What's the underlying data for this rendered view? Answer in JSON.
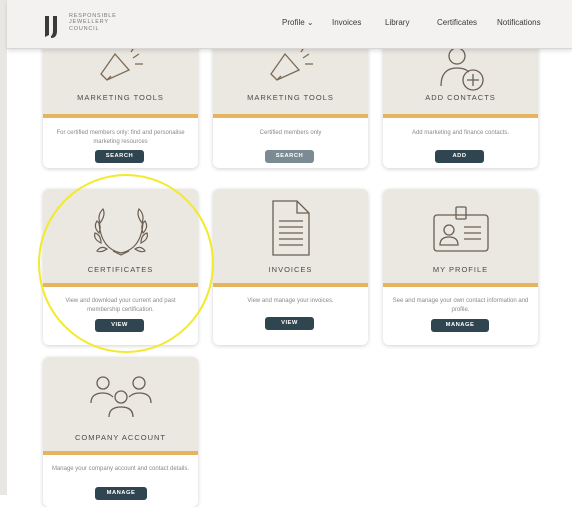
{
  "header": {
    "brand_lines": [
      "RESPONSIBLE",
      "JEWELLERY",
      "COUNCIL"
    ],
    "nav": [
      {
        "label": "Profile ⌄"
      },
      {
        "label": "Invoices"
      },
      {
        "label": "Library"
      },
      {
        "label": "Certificates"
      },
      {
        "label": "Notifications"
      }
    ]
  },
  "cards": [
    {
      "title": "MARKETING TOOLS",
      "desc": "For certified members only: find and personalise marketing resources",
      "button": "SEARCH",
      "icon": "megaphone-icon"
    },
    {
      "title": "MARKETING TOOLS",
      "desc": "Certified members only",
      "button": "SEARCH",
      "icon": "megaphone-icon",
      "disabled": true
    },
    {
      "title": "ADD CONTACTS",
      "desc": "Add marketing and finance contacts.",
      "button": "ADD",
      "icon": "add-contact-icon"
    },
    {
      "title": "CERTIFICATES",
      "desc": "View and download your current and past membership certification.",
      "button": "VIEW",
      "icon": "laurel-wreath-icon"
    },
    {
      "title": "INVOICES",
      "desc": "View and manage your invoices.",
      "button": "VIEW",
      "icon": "document-icon"
    },
    {
      "title": "MY PROFILE",
      "desc": "See and manage your own contact information and profile.",
      "button": "MANAGE",
      "icon": "id-badge-icon"
    },
    {
      "title": "COMPANY ACCOUNT",
      "desc": "Manage your company account and contact details.",
      "button": "MANAGE",
      "icon": "group-icon"
    }
  ],
  "colors": {
    "accent_bar": "#e6b35f",
    "button": "#2f4650",
    "button_disabled": "#7b8b92",
    "card_top": "#ebe7e1",
    "highlight": "#f2ea2a"
  }
}
